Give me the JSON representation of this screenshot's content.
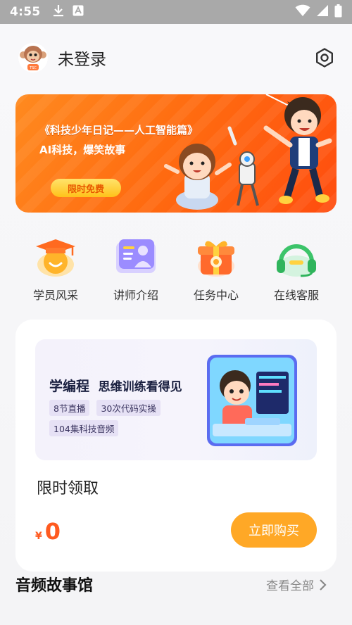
{
  "status_bar": {
    "time": "4:55",
    "icons": [
      "download-icon",
      "a-icon",
      "wifi-icon",
      "signal-icon",
      "battery-icon"
    ]
  },
  "header": {
    "login_status": "未登录",
    "avatar": "monkey-avatar",
    "settings_icon": "gear-icon"
  },
  "banner": {
    "title": "《科技少年日记——人工智能篇》",
    "subtitle": "AI科技，爆笑故事",
    "badge": "限时免费"
  },
  "menu": {
    "items": [
      {
        "label": "学员风采",
        "icon": "graduation-cap-icon"
      },
      {
        "label": "讲师介绍",
        "icon": "teacher-card-icon"
      },
      {
        "label": "任务中心",
        "icon": "gift-box-icon"
      },
      {
        "label": "在线客服",
        "icon": "headset-icon"
      }
    ]
  },
  "promo": {
    "course_title": "学编程",
    "course_slogan": "思维训练看得见",
    "tags": [
      "8节直播",
      "30次代码实操",
      "104集科技音频"
    ],
    "claim_label": "限时领取",
    "price_currency": "¥",
    "price_value": "0",
    "buy_button": "立即购买"
  },
  "audio_section": {
    "title": "音频故事馆",
    "see_all": "查看全部"
  },
  "colors": {
    "accent_orange": "#ff6a10",
    "button_orange": "#ffa826",
    "price_red": "#ff5a1f"
  }
}
